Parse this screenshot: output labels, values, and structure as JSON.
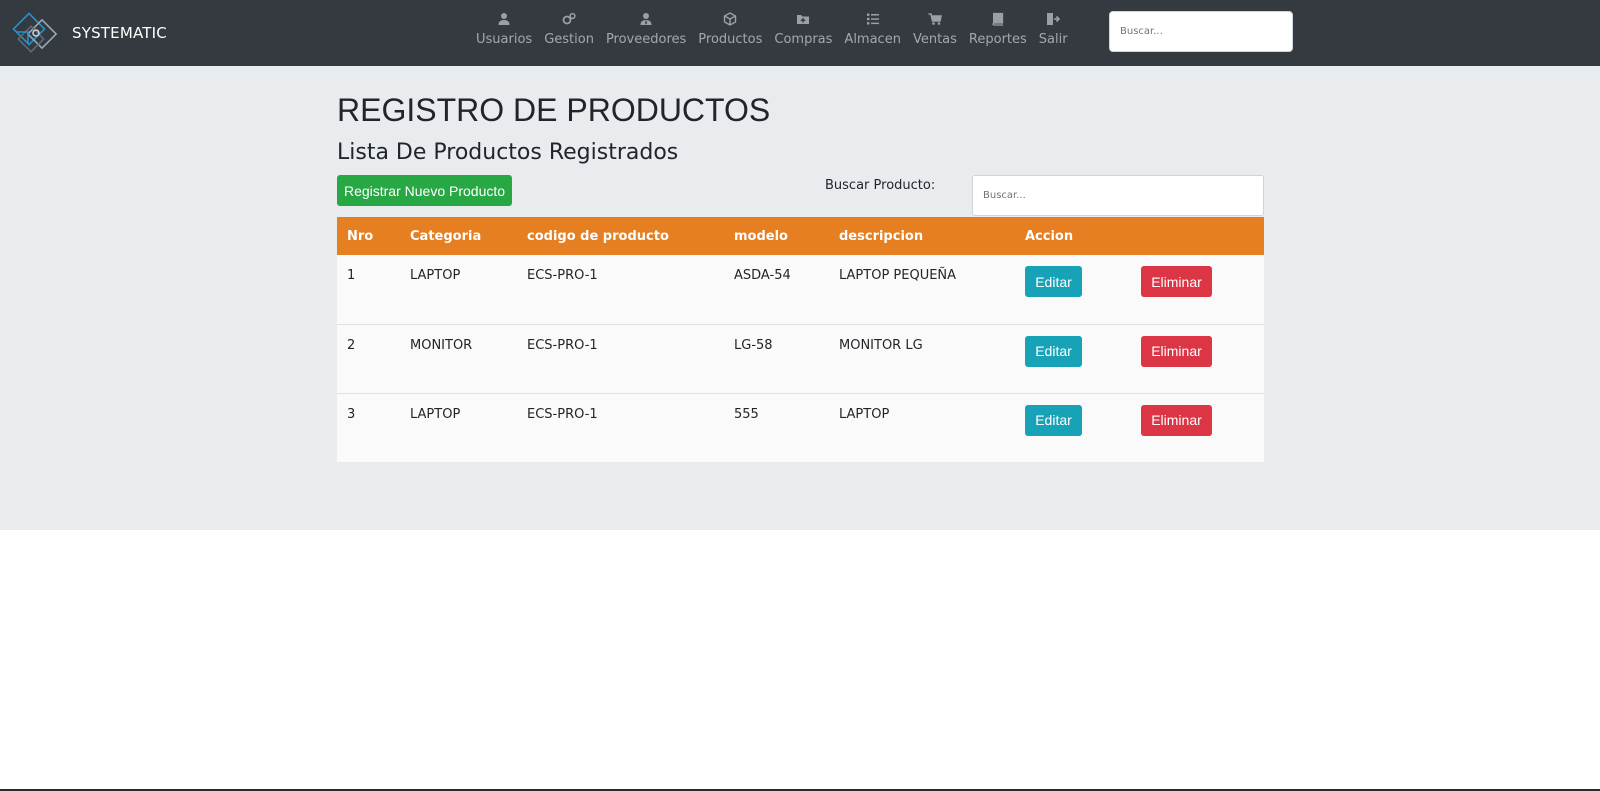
{
  "brand": {
    "name": "SYSTEMATIC"
  },
  "nav": {
    "items": [
      {
        "label": "Usuarios",
        "icon": "user-icon"
      },
      {
        "label": "Gestion",
        "icon": "gears-icon"
      },
      {
        "label": "Proveedores",
        "icon": "user-tie-icon"
      },
      {
        "label": "Productos",
        "icon": "box-icon"
      },
      {
        "label": "Compras",
        "icon": "folder-plus-icon"
      },
      {
        "label": "Almacen",
        "icon": "list-icon"
      },
      {
        "label": "Ventas",
        "icon": "cart-icon"
      },
      {
        "label": "Reportes",
        "icon": "book-icon"
      },
      {
        "label": "Salir",
        "icon": "sign-out-icon"
      }
    ],
    "search_placeholder": "Buscar..."
  },
  "page": {
    "title": "REGISTRO DE PRODUCTOS",
    "subtitle": "Lista De Productos Registrados",
    "register_button": "Registrar Nuevo Producto",
    "search_label": "Buscar Producto:",
    "search_placeholder": "Buscar..."
  },
  "table": {
    "headers": [
      "Nro",
      "Categoria",
      "codigo de producto",
      "modelo",
      "descripcion",
      "Accion"
    ],
    "edit_label": "Editar",
    "delete_label": "Eliminar",
    "rows": [
      {
        "nro": "1",
        "categoria": "LAPTOP",
        "codigo": "ECS-PRO-1",
        "modelo": "ASDA-54",
        "descripcion": "LAPTOP PEQUEÑA"
      },
      {
        "nro": "2",
        "categoria": "MONITOR",
        "codigo": "ECS-PRO-1",
        "modelo": "LG-58",
        "descripcion": "MONITOR LG"
      },
      {
        "nro": "3",
        "categoria": "LAPTOP",
        "codigo": "ECS-PRO-1",
        "modelo": "555",
        "descripcion": "LAPTOP"
      }
    ]
  },
  "colors": {
    "navbar": "#343a40",
    "content_background": "#e9ecef",
    "table_header": "#e67e22",
    "success": "#28a745",
    "info": "#17a2b8",
    "danger": "#dc3545"
  }
}
